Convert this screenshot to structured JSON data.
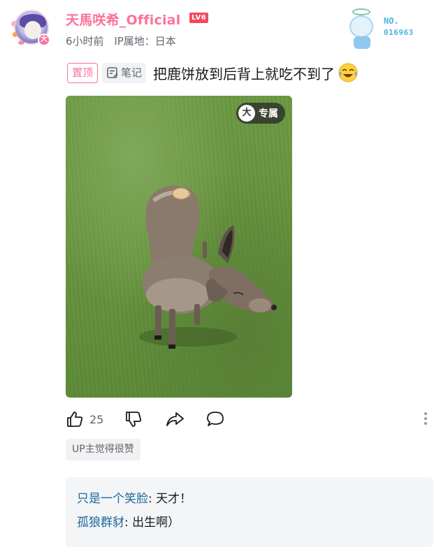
{
  "user": {
    "name": "天馬咲希_Official",
    "level": "LV6",
    "time": "6小时前",
    "ip_location": "IP属地：日本",
    "vip_badge": "大"
  },
  "fan_badge": {
    "no_label": "NO.",
    "number": "016963"
  },
  "post": {
    "pin_label": "置顶",
    "note_label": "笔记",
    "title": "把鹿饼放到后背上就吃不到了",
    "image_tag": "专属",
    "image_tag_icon": "大"
  },
  "actions": {
    "like_count": "25",
    "icons": [
      "thumbs-up-icon",
      "thumbs-down-icon",
      "share-icon",
      "comment-icon",
      "more-icon"
    ]
  },
  "up_liked": "UP主觉得很赞",
  "comments": [
    {
      "user": "只是一个笑脸",
      "text": ": 天才！"
    },
    {
      "user": "孤狼群豺",
      "text": ": 出生啊）"
    }
  ],
  "colors": {
    "brand_pink": "#fb7299",
    "level_red": "#f2495c",
    "comment_user_blue": "#1b6a9d",
    "text_gray": "#61666d"
  }
}
